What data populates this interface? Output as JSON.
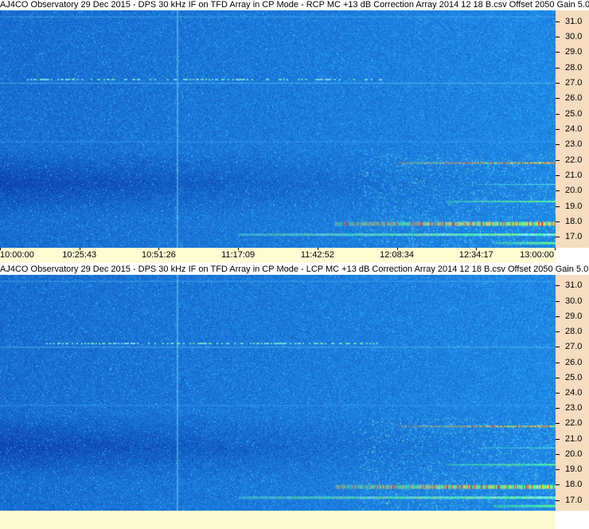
{
  "chart_data": [
    {
      "type": "heatmap",
      "title": "AJ4CO Observatory 29 Dec 2015 - DPS 30 kHz IF on TFD Array in CP Mode - RCP  MC +13 dB  Correction Array 2014 12 18 B.csv  Offset 2050  Gain 5.0",
      "x_ticks": [
        "10:00:00",
        "10:25:43",
        "10:51:26",
        "11:17:09",
        "11:42:52",
        "12:08:34",
        "12:34:17",
        "13:00:00"
      ],
      "y_ticks": [
        "31.0",
        "30.0",
        "29.0",
        "28.0",
        "27.0",
        "26.0",
        "25.0",
        "24.0",
        "23.0",
        "22.0",
        "21.0",
        "20.0",
        "19.0",
        "18.0",
        "17.0"
      ],
      "ylim": [
        16.3,
        31.7
      ]
    },
    {
      "type": "heatmap",
      "title": "AJ4CO Observatory 29 Dec 2015 - DPS 30 kHz IF on TFD Array in CP Mode - LCP  MC +13 dB  Correction Array 2014 12 18 B.csv  Offset 2050  Gain 5.0",
      "x_ticks": [],
      "y_ticks": [
        "31.0",
        "30.0",
        "29.0",
        "28.0",
        "27.0",
        "26.0",
        "25.0",
        "24.0",
        "23.0",
        "22.0",
        "21.0",
        "20.0",
        "19.0",
        "18.0",
        "17.0"
      ],
      "ylim": [
        16.3,
        31.7
      ]
    }
  ],
  "colors": {
    "background_blue": "#1a5fe0",
    "deep_blue": "#0d3fb8",
    "noise_cyan": "#2fb7ff",
    "burst_green": "#7cff6a",
    "burst_red": "#ff3040",
    "axis_bg": "#f6dcc0",
    "time_bg": "#fdfbd2"
  }
}
